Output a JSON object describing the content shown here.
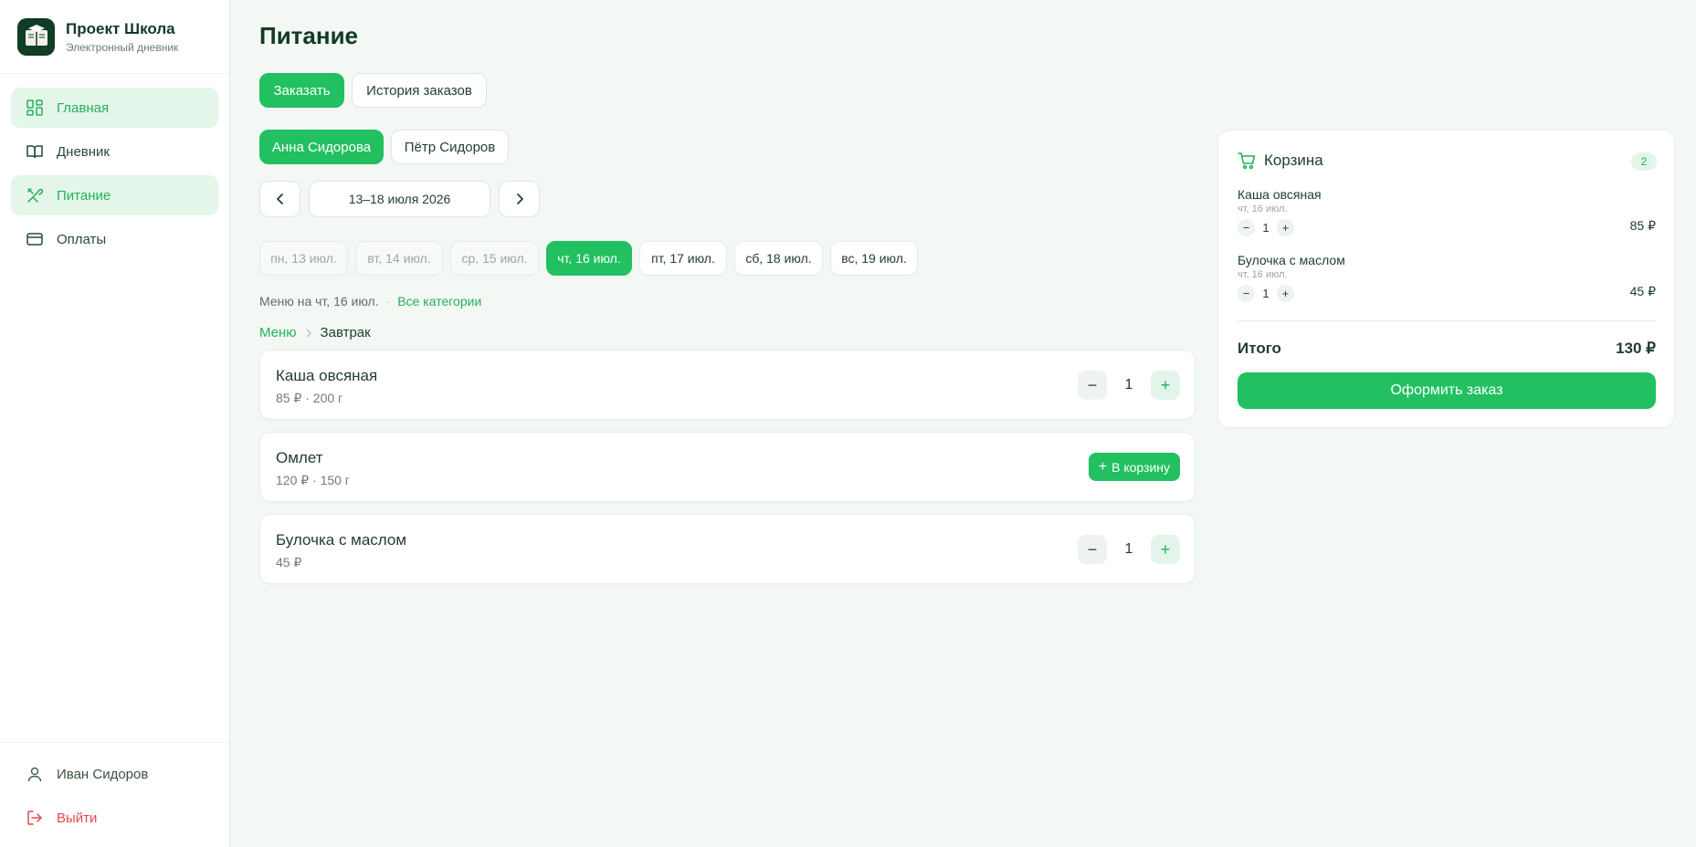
{
  "brand": {
    "title": "Проект Школа",
    "subtitle": "Электронный дневник"
  },
  "nav": [
    {
      "label": "Главная",
      "icon": "dashboard-icon"
    },
    {
      "label": "Дневник",
      "icon": "book-icon"
    },
    {
      "label": "Питание",
      "icon": "utensils-icon"
    },
    {
      "label": "Оплаты",
      "icon": "credit-card-icon"
    }
  ],
  "user": {
    "name": "Иван Сидоров",
    "logout": "Выйти"
  },
  "page": {
    "title": "Питание"
  },
  "tabs": {
    "order": "Заказать",
    "history": "История заказов"
  },
  "students": [
    "Анна Сидорова",
    "Пётр Сидоров"
  ],
  "week": {
    "label": "13–18 июля 2026"
  },
  "days": [
    "пн, 13 июл.",
    "вт, 14 июл.",
    "ср, 15 июл.",
    "чт, 16 июл.",
    "пт, 17 июл.",
    "сб, 18 июл.",
    "вс, 19 июл."
  ],
  "menu_info": {
    "text": "Меню на чт, 16 июл.",
    "all_categories": "Все категории"
  },
  "breadcrumb": {
    "root": "Меню",
    "current": "Завтрак"
  },
  "items": [
    {
      "name": "Каша овсяная",
      "meta": "85 ₽ · 200 г",
      "qty": "1"
    },
    {
      "name": "Омлет",
      "meta": "120 ₽ · 150 г",
      "add_label": "В корзину"
    },
    {
      "name": "Булочка с маслом",
      "meta": "45 ₽",
      "qty": "1"
    }
  ],
  "cart": {
    "title": "Корзина",
    "count": "2",
    "items": [
      {
        "name": "Каша овсяная",
        "date": "чт, 16 июл.",
        "qty": "1",
        "price": "85 ₽"
      },
      {
        "name": "Булочка с маслом",
        "date": "чт, 16 июл.",
        "qty": "1",
        "price": "45 ₽"
      }
    ],
    "total_label": "Итого",
    "total_value": "130 ₽",
    "checkout": "Оформить заказ"
  },
  "colors": {
    "accent": "#22c061",
    "accent_light": "#e3f5ea",
    "danger": "#e5484d",
    "text": "#1f3d2c",
    "background": "#f3f8f4"
  }
}
